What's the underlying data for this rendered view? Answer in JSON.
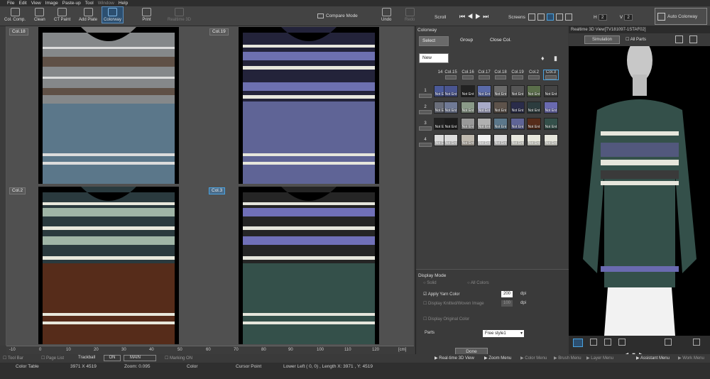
{
  "menu": [
    "File",
    "Edit",
    "View",
    "Image",
    "Paste-up",
    "Tool",
    "Window",
    "Help"
  ],
  "toolbar": {
    "col_comp": "Col. Comp.",
    "clean": "Clean",
    "ct_paint": "CT Paint",
    "add_plate": "Add Plate",
    "colorway": "Colorway",
    "print": "Print",
    "realtime3d": "Realtime 3D",
    "compare_mode": "Compare Mode",
    "undo": "Undo",
    "redo": "Redo",
    "scroll": "Scroll",
    "screens": "Screens",
    "h_label": "H",
    "h_value": "2",
    "v_label": "V",
    "v_value": "2",
    "auto_colorway": "Auto Colorway"
  },
  "canvas": {
    "labels": [
      "Col.18",
      "Col.19",
      "Col.2",
      "Col.3"
    ],
    "selected_label": "Col.3"
  },
  "ruler": {
    "ticks": [
      "-10",
      "0",
      "10",
      "20",
      "30",
      "40",
      "50",
      "60",
      "70",
      "80",
      "90",
      "100",
      "110",
      "120"
    ],
    "unit": "[cm]"
  },
  "colorway_panel": {
    "title": "Colorway",
    "select": "Select",
    "group": "Group",
    "close_col": "Close Col.",
    "new": "New",
    "columns": [
      "14",
      "Col.15",
      "Col.16",
      "Col.17",
      "Col.18",
      "Col.19",
      "Col.2",
      "Col.3"
    ],
    "rows": [
      "1",
      "2",
      "3",
      "4"
    ],
    "not_ent": "Not Ent",
    "display_mode": "Display Mode",
    "solid": "Solid",
    "all_colors": "All Colors",
    "apply_yarn_color": "Apply Yarn Color",
    "apply_yarn_dpi": "200",
    "display_knitted": "Display Knitted/Woven Image",
    "knitted_dpi": "100",
    "dpi": "dpi",
    "display_original": "Display Original Color",
    "parts_label": "Parts",
    "parts_value": "Free style1",
    "done": "Done"
  },
  "view3d": {
    "title": "Realtime 3D View[TV181097-1STAF02]",
    "simulation": "Simulation",
    "all_parts": "All Parts"
  },
  "bottom_strip": {
    "tool_bar": "Tool Bar",
    "page_list": "Page List",
    "trackball": "Trackball",
    "on": "ON",
    "main": "MAIN",
    "marking_on": "Marking ON",
    "realtime_view": "Real-time 3D View",
    "zoom_menu": "Zoom Menu",
    "color_menu": "Color Menu",
    "brush_menu": "Brush Menu",
    "layer_menu": "Layer Menu",
    "assistant_menu": "Assistant Menu",
    "work_menu": "Work Menu"
  },
  "status": {
    "color_table": "Color Table",
    "dims": "3971 X 4519",
    "zoom": "Zoom: 0.095",
    "color": "Color",
    "cursor_point": "Cursor Point",
    "lower_left": "Lower Left (   0,     0) , Length  X: 3971 , Y: 4519"
  },
  "colors": {
    "accent": "#4aa3e0",
    "sweater_blue": "#5b778a",
    "sweater_purple": "#5f6496",
    "sweater_brown": "#562c1a",
    "sweater_green": "#34504a"
  }
}
